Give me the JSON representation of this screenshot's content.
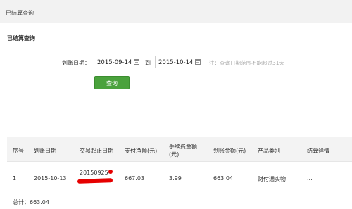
{
  "header": {
    "title": "已结算查询"
  },
  "section": {
    "title": "已结算查询"
  },
  "form": {
    "date_label": "划账日期：",
    "start_date": "2015-09-14",
    "to_label": "到",
    "end_date": "2015-10-14",
    "hint": "注：查询日期范围不能超过31天",
    "query_button": "查询"
  },
  "table": {
    "headers": [
      "序号",
      "划账日期",
      "交易起止日期",
      "支付净额(元)",
      "手续费金额\n(元)",
      "划账金额(元)",
      "产品类别",
      "结算详情"
    ],
    "rows": [
      {
        "index": "1",
        "settle_date": "2015-10-13",
        "trade_period": "20150925-",
        "net_amount": "667.03",
        "fee": "3.99",
        "settle_amount": "663.04",
        "product": "财付通实物",
        "detail": "..."
      }
    ]
  },
  "total": {
    "text": "总计：663.04"
  },
  "colors": {
    "accent_green": "#4aa23c",
    "redaction": "#e60000"
  }
}
